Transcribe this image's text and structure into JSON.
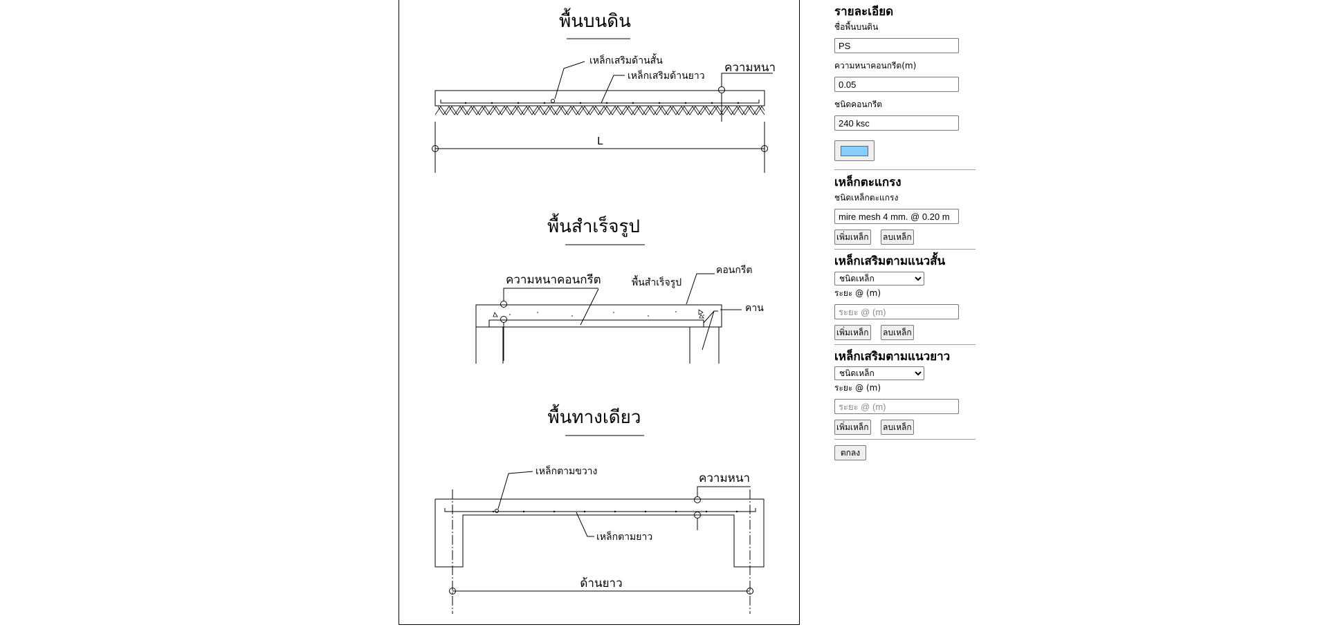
{
  "drawing": {
    "slab_on_ground": {
      "title": "พื้นบนดิน",
      "label_short_rebar": "เหล็กเสริมด้านสั้น",
      "label_long_rebar": "เหล็กเสริมด้านยาว",
      "label_thickness": "ความหนา",
      "label_length": "L"
    },
    "precast_slab": {
      "title": "พื้นสำเร็จรูป",
      "label_concrete_thickness": "ความหนาคอนกรีต",
      "label_precast": "พื้นสำเร็จรูป",
      "label_concrete": "คอนกรีต",
      "label_beam": "คาน"
    },
    "one_way_slab": {
      "title": "พื้นทางเดียว",
      "label_transverse_rebar": "เหล็กตามขวาง",
      "label_thickness": "ความหนา",
      "label_longitudinal_rebar": "เหล็กตามยาว",
      "label_long_side": "ด้านยาว"
    }
  },
  "form": {
    "details": {
      "title": "รายละเอียด",
      "name_label": "ชื่อพื้นบนดิน",
      "name_value": "PS",
      "thickness_label": "ความหนาคอนกรีต(m)",
      "thickness_value": "0.05",
      "concrete_type_label": "ชนิดคอนกรีต",
      "concrete_type_value": "240 ksc",
      "color_value": "#87cefa"
    },
    "mesh": {
      "title": "เหล็กตะแกรง",
      "type_label": "ชนิดเหล็กตะแกรง",
      "type_value": "mire mesh 4 mm. @ 0.20 m",
      "add_label": "เพิ่มเหล็ก",
      "delete_label": "ลบเหล็ก"
    },
    "short_rebar": {
      "title": "เหล็กเสริมตามแนวสั้น",
      "select_value": "ชนิดเหล็ก",
      "spacing_label": "ระยะ @ (m)",
      "spacing_placeholder": "ระยะ @ (m)",
      "add_label": "เพิ่มเหล็ก",
      "delete_label": "ลบเหล็ก"
    },
    "long_rebar": {
      "title": "เหล็กเสริมตามแนวยาว",
      "select_value": "ชนิดเหล็ก",
      "spacing_label": "ระยะ @ (m)",
      "spacing_placeholder": "ระยะ @ (m)",
      "add_label": "เพิ่มเหล็ก",
      "delete_label": "ลบเหล็ก"
    },
    "ok_label": "ตกลง"
  }
}
